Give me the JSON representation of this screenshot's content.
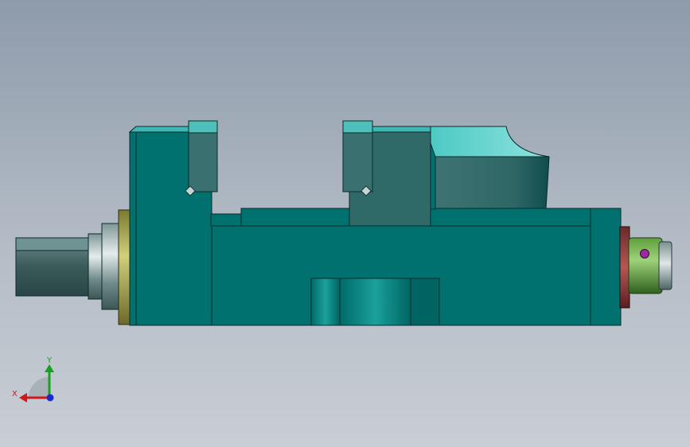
{
  "scene": {
    "background_top": "#8e9bab",
    "background_bottom": "#c9ced4",
    "model_color": "#00716f",
    "edge_color": "#0b2b2a"
  },
  "triad": {
    "x_label": "X",
    "y_label": "Y",
    "x_color": "#d01818",
    "y_color": "#18a020",
    "z_color": "#1a2ad0"
  }
}
